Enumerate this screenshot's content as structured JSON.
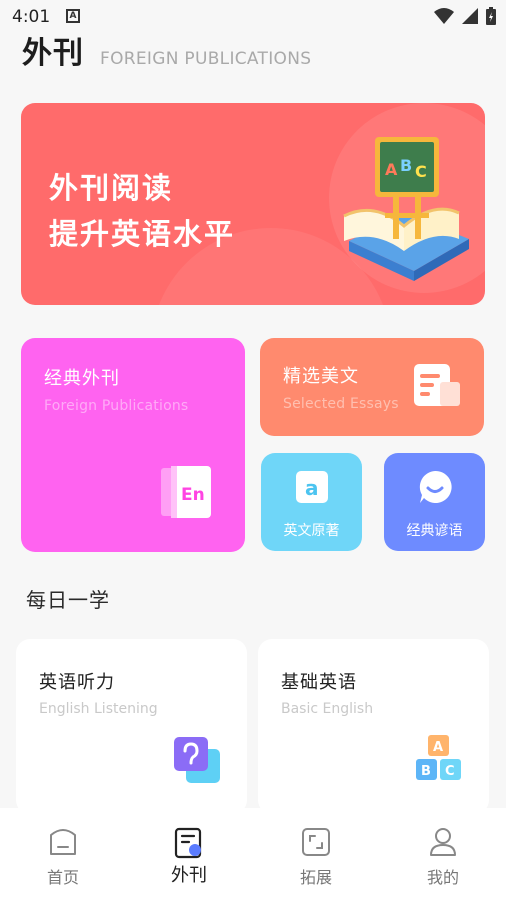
{
  "status_bar": {
    "time": "4:01",
    "notification_letter": "A"
  },
  "header": {
    "title": "外刊",
    "subtitle": "FOREIGN PUBLICATIONS"
  },
  "banner": {
    "line1": "外刊阅读",
    "line2": "提升英语水平",
    "board_letters": [
      "A",
      "B",
      "C"
    ],
    "color": "#ff6b6b"
  },
  "cards": {
    "publications": {
      "title": "经典外刊",
      "subtitle": "Foreign Publications",
      "badge": "En",
      "color": "#ff63f0"
    },
    "essays": {
      "title": "精选美文",
      "subtitle": "Selected Essays",
      "color": "#ff8a6e"
    },
    "original": {
      "label": "英文原著",
      "badge": "a",
      "color": "#6fd6f8"
    },
    "sayings": {
      "label": "经典谚语",
      "color": "#6e8bff"
    }
  },
  "daily": {
    "section_title": "每日一学",
    "items": [
      {
        "title": "英语听力",
        "subtitle": "English Listening"
      },
      {
        "title": "基础英语",
        "subtitle": "Basic English",
        "blocks": [
          "A",
          "B",
          "C"
        ]
      }
    ]
  },
  "tabbar": {
    "active": "外刊",
    "tabs": [
      {
        "label": "首页",
        "icon": "home-icon"
      },
      {
        "label": "外刊",
        "icon": "publication-icon"
      },
      {
        "label": "拓展",
        "icon": "expand-icon"
      },
      {
        "label": "我的",
        "icon": "profile-icon"
      }
    ]
  }
}
